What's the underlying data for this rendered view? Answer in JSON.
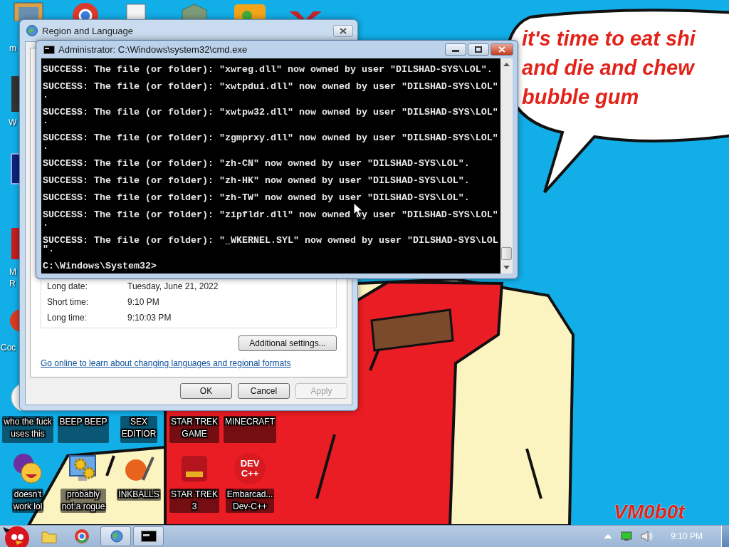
{
  "wallpaper": {
    "speech_bubble": [
      "it's time to eat shi",
      "and die and chew",
      "bubble gum"
    ],
    "signature": "VM0b0t"
  },
  "desktop": {
    "left_labels": [
      "m",
      "W",
      "M\nR",
      "Coc"
    ],
    "row_1": [
      "who the fuck\nuses this",
      "BEEP BEEP",
      "SEX\nEDITIOR",
      "STAR TREK\nGAME",
      "MINECRAFT"
    ],
    "row_2": [
      {
        "label": "doesn't\nwork lol",
        "kind": "messenger"
      },
      {
        "label": "probably\nnot a rogue",
        "kind": "settings"
      },
      {
        "label": "INKBALLS",
        "kind": "inkball"
      },
      {
        "label": "STAR TREK\n3",
        "kind": "game"
      },
      {
        "label": "Embarcad...\nDev-C++",
        "kind": "ide",
        "icon_text": "DEV\nC++"
      }
    ]
  },
  "region_dialog": {
    "title": "Region and Language",
    "formats": [
      {
        "label": "Long date:",
        "value": "Tuesday, June 21, 2022"
      },
      {
        "label": "Short time:",
        "value": "9:10 PM"
      },
      {
        "label": "Long time:",
        "value": "9:10:03 PM"
      }
    ],
    "additional_button": "Additional settings...",
    "link": "Go online to learn about changing languages and regional formats",
    "buttons": [
      {
        "label": "OK",
        "disabled": false
      },
      {
        "label": "Cancel",
        "disabled": false
      },
      {
        "label": "Apply",
        "disabled": true
      }
    ]
  },
  "cmd_window": {
    "title": "Administrator: C:\\Windows\\system32\\cmd.exe",
    "output": [
      "SUCCESS: The file (or folder): \"xwreg.dll\" now owned by user \"DILSHAD-SYS\\LOL\".",
      "SUCCESS: The file (or folder): \"xwtpdui.dll\" now owned by user \"DILSHAD-SYS\\LOL\".",
      "SUCCESS: The file (or folder): \"xwtpw32.dll\" now owned by user \"DILSHAD-SYS\\LOL\".",
      "SUCCESS: The file (or folder): \"zgmprxy.dll\" now owned by user \"DILSHAD-SYS\\LOL\".",
      "SUCCESS: The file (or folder): \"zh-CN\" now owned by user \"DILSHAD-SYS\\LOL\".",
      "SUCCESS: The file (or folder): \"zh-HK\" now owned by user \"DILSHAD-SYS\\LOL\".",
      "SUCCESS: The file (or folder): \"zh-TW\" now owned by user \"DILSHAD-SYS\\LOL\".",
      "SUCCESS: The file (or folder): \"zipfldr.dll\" now owned by user \"DILSHAD-SYS\\LOL\".",
      "SUCCESS: The file (or folder): \"_WKERNEL.SYL\" now owned by user \"DILSHAD-SYS\\LOL\"."
    ],
    "prompt": "C:\\Windows\\System32>"
  },
  "taskbar": {
    "clock": "9:10 PM"
  }
}
